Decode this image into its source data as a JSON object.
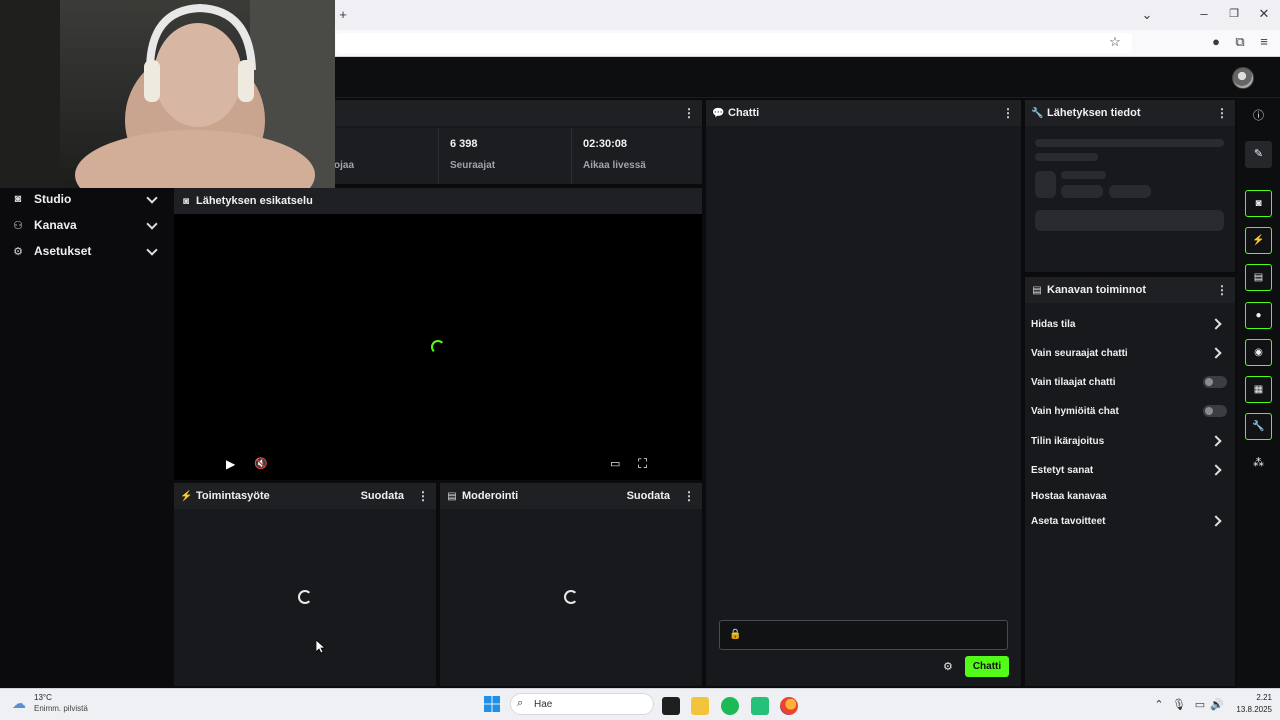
{
  "browser": {
    "new_tab_icon": "plus-icon",
    "window_controls": [
      "minimize-icon",
      "maximize-icon",
      "close-icon"
    ],
    "url_bar_icons": [
      "star-icon",
      "account-icon",
      "extensions-icon",
      "menu-icon"
    ]
  },
  "brand": {
    "accent": "#53fc18"
  },
  "nav": {
    "items": [
      {
        "label": "Studio",
        "icon": "studio-icon"
      },
      {
        "label": "Kanava",
        "icon": "channel-icon"
      },
      {
        "label": "Asetukset",
        "icon": "gear-icon"
      }
    ]
  },
  "stats_panel": {
    "stats": [
      {
        "value": "",
        "label": "ojaa"
      },
      {
        "value": "6 398",
        "label": "Seuraajat"
      },
      {
        "value": "02:30:08",
        "label": "Aikaa livessä"
      }
    ]
  },
  "preview": {
    "title": "Lähetyksen esikatselu",
    "controls": [
      "play-icon",
      "mute-icon",
      "theater-icon",
      "fullscreen-icon"
    ]
  },
  "activity": {
    "title": "Toimintasyöte",
    "filter_label": "Suodata"
  },
  "moderation": {
    "title": "Moderointi",
    "filter_label": "Suodata"
  },
  "chat": {
    "title": "Chatti",
    "input_placeholder": "",
    "send_label": "Chatti"
  },
  "stream_info": {
    "title": "Lähetyksen tiedot"
  },
  "channel_actions": {
    "title": "Kanavan toiminnot",
    "items": [
      {
        "label": "Hidas tila",
        "control": "chevron"
      },
      {
        "label": "Vain seuraajat chatti",
        "control": "chevron"
      },
      {
        "label": "Vain tilaajat chatti",
        "control": "toggle",
        "on": false
      },
      {
        "label": "Vain hymiöitä chat",
        "control": "toggle",
        "on": false
      },
      {
        "label": "Tilin ikärajoitus",
        "control": "chevron"
      },
      {
        "label": "Estetyt sanat",
        "control": "chevron"
      },
      {
        "label": "Hostaa kanavaa",
        "control": "none"
      },
      {
        "label": "Aseta tavoitteet",
        "control": "chevron"
      }
    ]
  },
  "right_sidebar": {
    "icons": [
      "info-icon",
      "edit-icon",
      "preview-icon",
      "activity-icon",
      "moderation-icon",
      "chat-icon",
      "broadcast-icon",
      "channel-actions-icon",
      "wrench-icon",
      "more-icon"
    ]
  },
  "taskbar": {
    "weather_temp": "13°C",
    "weather_desc": "Enimm. pilvistä",
    "search_placeholder": "Hae",
    "time": "2.21",
    "date": "13.8.2025"
  }
}
